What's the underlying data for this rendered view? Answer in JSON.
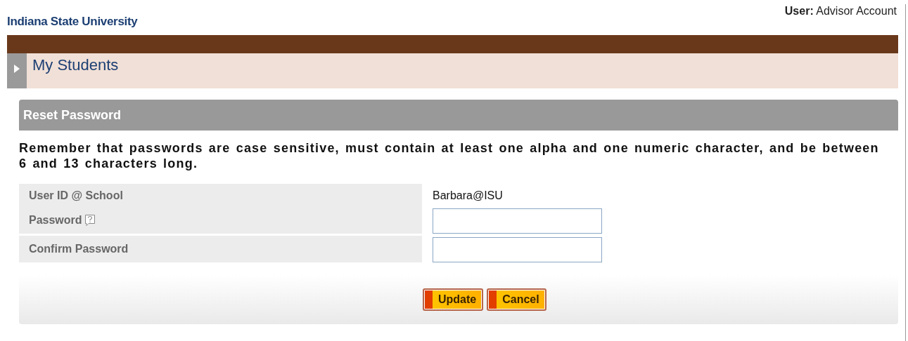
{
  "header": {
    "site_title": "Indiana State University",
    "user_label": "User:",
    "user_name": "Advisor Account"
  },
  "section": {
    "title": "My Students",
    "expanded": false
  },
  "panel": {
    "title": "Reset Password",
    "instructions": "Remember that passwords are case sensitive, must contain at least one alpha and one numeric character, and be between 6 and 13 characters long."
  },
  "form": {
    "groups": [
      [
        {
          "label": "User ID @ School",
          "kind": "text",
          "value": "Barbara@ISU",
          "help": false
        },
        {
          "label": "Password",
          "kind": "input",
          "help": true
        }
      ],
      [
        {
          "label": "Confirm Password",
          "kind": "input",
          "help": false
        }
      ]
    ]
  },
  "buttons": [
    "Update",
    "Cancel"
  ]
}
